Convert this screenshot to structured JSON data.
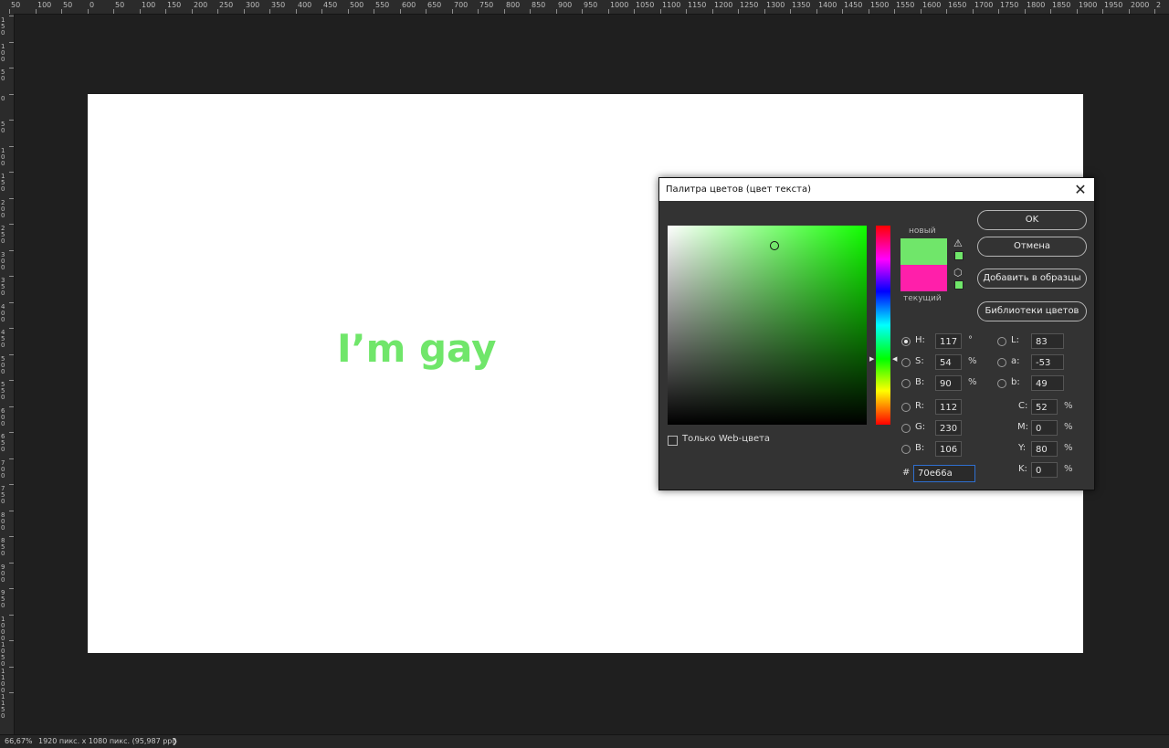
{
  "ruler": {
    "top_labels": [
      "50",
      "100",
      "50",
      "0",
      "50",
      "100",
      "150",
      "200",
      "250",
      "300",
      "350",
      "400",
      "450",
      "500",
      "550",
      "600",
      "650",
      "700",
      "750",
      "800",
      "850",
      "900",
      "950",
      "1000",
      "1050",
      "1100",
      "1150",
      "1200",
      "1250",
      "1300",
      "1350",
      "1400",
      "1450",
      "1500",
      "1550",
      "1600",
      "1650",
      "1700",
      "1750",
      "1800",
      "1850",
      "1900",
      "1950",
      "2000",
      "2"
    ],
    "left_labels": [
      "150",
      "100",
      "50",
      "0",
      "50",
      "100",
      "150",
      "200",
      "250",
      "300",
      "350",
      "400",
      "450",
      "500",
      "550",
      "600",
      "650",
      "700",
      "750",
      "800",
      "850",
      "900",
      "950",
      "1000",
      "1050",
      "1100",
      "1150"
    ]
  },
  "canvas": {
    "text": "I’m gay",
    "text_color": "#70e66a",
    "background": "#ffffff"
  },
  "status": {
    "zoom": "66,67%",
    "doc_info": "1920 пикс. x 1080 пикс. (95,987 ppi)",
    "arrow": "❯"
  },
  "dialog": {
    "title": "Палитра цветов (цвет текста)",
    "close": "✕",
    "new_label": "новый",
    "current_label": "текущий",
    "new_color": "#70e66a",
    "current_color": "#ff1faa",
    "web_only_label": "Только Web-цвета",
    "web_only_checked": false,
    "buttons": {
      "ok": "OK",
      "cancel": "Отмена",
      "add_swatch": "Добавить в образцы",
      "libraries": "Библиотеки цветов"
    },
    "hsb": {
      "h_label": "H:",
      "h": "117",
      "h_unit": "°",
      "s_label": "S:",
      "s": "54",
      "s_unit": "%",
      "b_label": "B:",
      "b": "90",
      "b_unit": "%"
    },
    "rgb": {
      "r_label": "R:",
      "r": "112",
      "g_label": "G:",
      "g": "230",
      "b_label": "B:",
      "b": "106"
    },
    "lab": {
      "l_label": "L:",
      "l": "83",
      "a_label": "a:",
      "a": "-53",
      "b_label": "b:",
      "b": "49"
    },
    "cmyk": {
      "c_label": "C:",
      "c": "52",
      "m_label": "M:",
      "m": "0",
      "y_label": "Y:",
      "y": "80",
      "k_label": "K:",
      "k": "0",
      "unit": "%"
    },
    "hex_label": "#",
    "hex": "70e66a"
  }
}
